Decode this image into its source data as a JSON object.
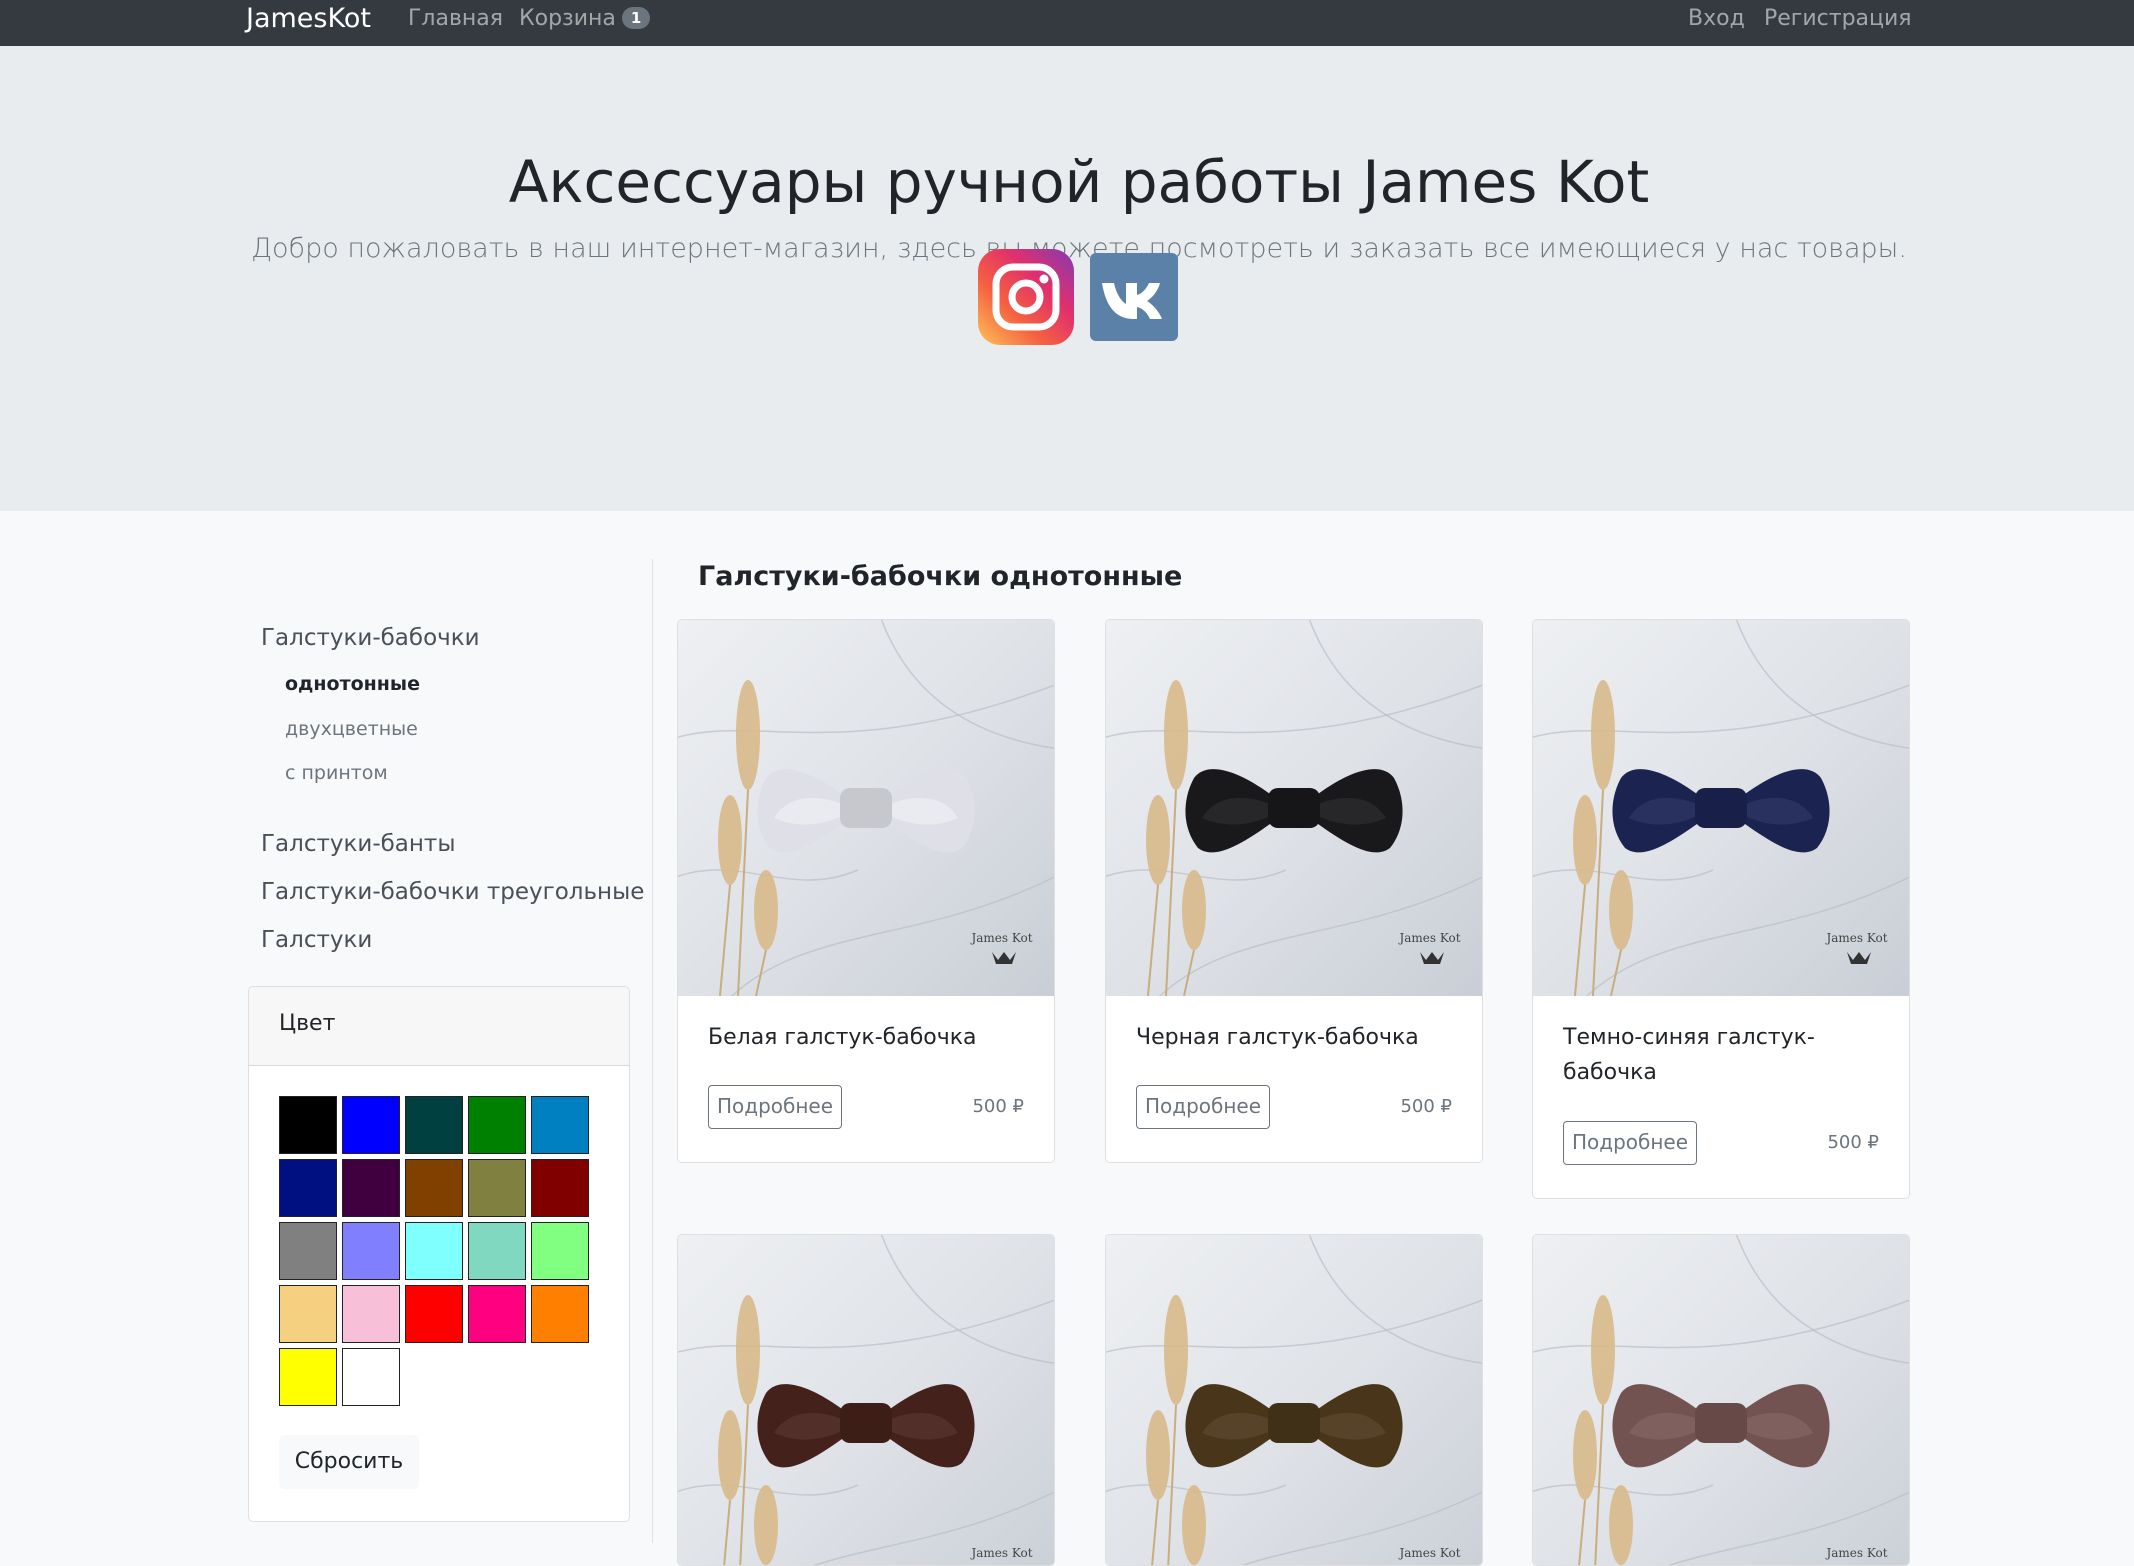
{
  "navbar": {
    "brand": "JamesKot",
    "home": "Главная",
    "cart": "Корзина",
    "cart_count": "1",
    "login": "Вход",
    "register": "Регистрация"
  },
  "hero": {
    "title": "Аксессуары ручной работы James Kot",
    "lead": "Добро пожаловать в наш интернет-магазин, здесь вы можете посмотреть и заказать все имеющиеся у нас товары.",
    "social": [
      "instagram-icon",
      "vk-icon"
    ]
  },
  "sidebar": {
    "categories": [
      {
        "label": "Галстуки-бабочки",
        "subs": [
          "однотонные",
          "двухцветные",
          "с принтом"
        ],
        "active_sub": "однотонные"
      },
      {
        "label": "Галстуки-банты"
      },
      {
        "label": "Галстуки-бабочки треугольные"
      },
      {
        "label": "Галстуки"
      }
    ],
    "filter": {
      "title": "Цвет",
      "reset": "Сбросить",
      "colors": [
        "#000000",
        "#0000ff",
        "#004040",
        "#008000",
        "#0080c0",
        "#001080",
        "#400040",
        "#804000",
        "#808040",
        "#800000",
        "#808080",
        "#8080ff",
        "#80ffff",
        "#80d8c0",
        "#80ff80",
        "#f5d080",
        "#f8c0d8",
        "#ff0000",
        "#ff0080",
        "#ff8000",
        "#ffff00",
        "#ffffff"
      ]
    }
  },
  "main": {
    "title": "Галстуки-бабочки однотонные",
    "more_label": "Подробнее",
    "products": [
      {
        "title": "Белая галстук-бабочка",
        "price": "500 ₽",
        "tie_color": "#f2f4fb"
      },
      {
        "title": "Черная галстук-бабочка",
        "price": "500 ₽",
        "tie_color": "#1b1b1d"
      },
      {
        "title": "Темно-синяя галстук-бабочка",
        "price": "500 ₽",
        "tie_color": "#1d2658"
      },
      {
        "title": "",
        "price": "",
        "tie_color": "#4a241c"
      },
      {
        "title": "",
        "price": "",
        "tie_color": "#4e3a1c"
      },
      {
        "title": "",
        "price": "",
        "tie_color": "#7d5a58"
      }
    ],
    "watermark": "James Kot"
  }
}
